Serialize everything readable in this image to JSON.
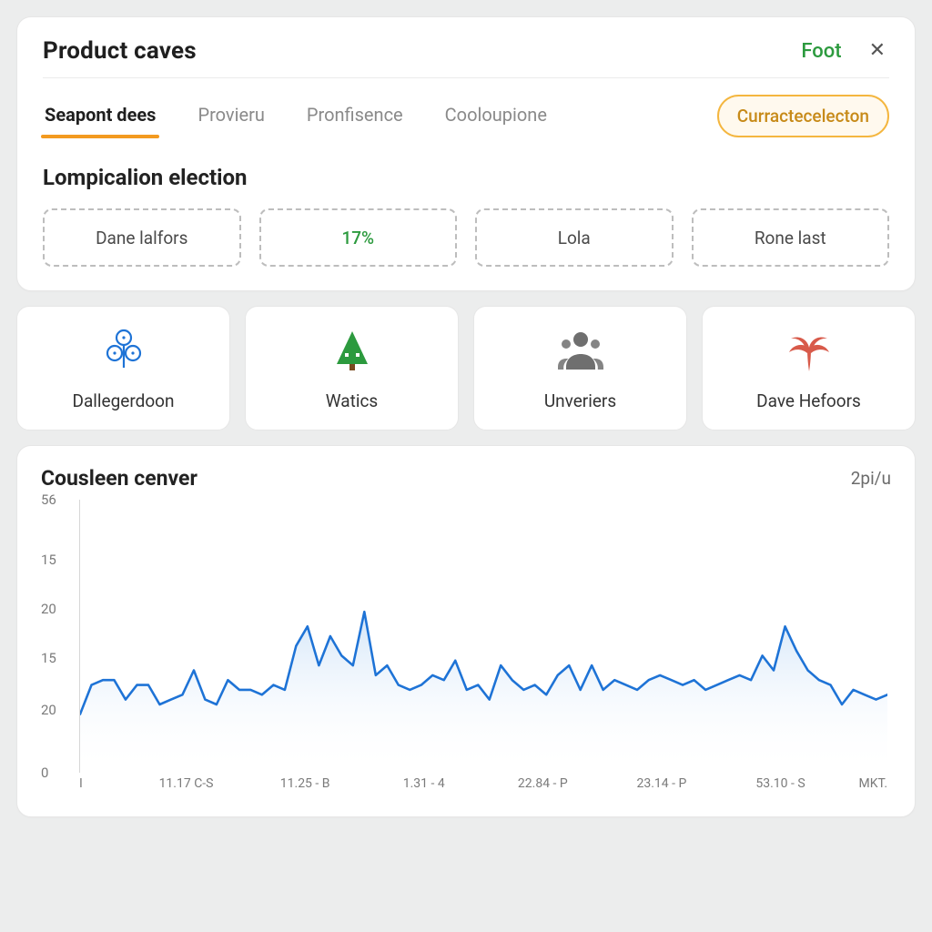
{
  "header": {
    "title": "Product caves",
    "foot_label": "Foot",
    "close_glyph": "✕"
  },
  "tabs": [
    {
      "label": "Seapont dees",
      "active": true
    },
    {
      "label": "Provieru",
      "active": false
    },
    {
      "label": "Pronfisence",
      "active": false
    },
    {
      "label": "Cooloupione",
      "active": false
    }
  ],
  "tab_pill": {
    "label": "Curractecelecton"
  },
  "section": {
    "title": "Lompicalion election",
    "options": [
      {
        "label": "Dane lalfors",
        "variant": "plain"
      },
      {
        "label": "17%",
        "variant": "green"
      },
      {
        "label": "Lola",
        "variant": "plain"
      },
      {
        "label": "Rone last",
        "variant": "plain"
      }
    ]
  },
  "features": [
    {
      "label": "Dallegerdoon",
      "icon": "clover-icon"
    },
    {
      "label": "Watics",
      "icon": "tree-icon"
    },
    {
      "label": "Unveriers",
      "icon": "people-icon"
    },
    {
      "label": "Dave Hefoors",
      "icon": "palm-icon"
    }
  ],
  "chart": {
    "title": "Cousleen cenver",
    "meta": "2pi/u"
  },
  "chart_data": {
    "type": "line",
    "title": "Cousleen cenver",
    "xlabel": "",
    "ylabel": "",
    "ylim": [
      0,
      56
    ],
    "y_ticks": [
      56,
      15,
      20,
      15,
      20,
      0
    ],
    "categories": [
      "I",
      "11.17 C-S",
      "11.25 - B",
      "1.31 - 4",
      "22.84 - P",
      "23.14 - P",
      "53.10 - S",
      "MKT."
    ],
    "values": [
      12,
      18,
      19,
      19,
      15,
      18,
      18,
      14,
      15,
      16,
      21,
      15,
      14,
      19,
      17,
      17,
      16,
      18,
      17,
      26,
      30,
      22,
      28,
      24,
      22,
      33,
      20,
      22,
      18,
      17,
      18,
      20,
      19,
      23,
      17,
      18,
      15,
      22,
      19,
      17,
      18,
      16,
      20,
      22,
      17,
      22,
      17,
      19,
      18,
      17,
      19,
      20,
      19,
      18,
      19,
      17,
      18,
      19,
      20,
      19,
      24,
      21,
      30,
      25,
      21,
      19,
      18,
      14,
      17,
      16,
      15,
      16
    ]
  },
  "colors": {
    "accent_orange": "#f39a1f",
    "accent_green": "#2c9a3e",
    "chart_blue": "#1e73d6"
  }
}
